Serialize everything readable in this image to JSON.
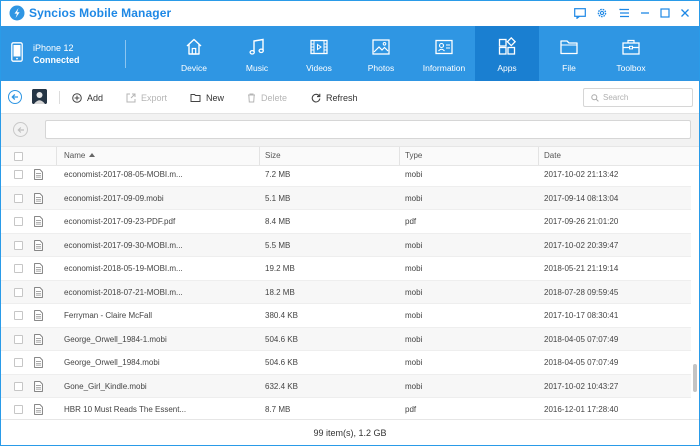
{
  "app": {
    "title": "Syncios Mobile Manager",
    "accent_color": "#2f96e3",
    "window_controls": [
      "message-icon",
      "gear-icon",
      "menu-icon",
      "minimize-icon",
      "maximize-icon",
      "close-icon"
    ]
  },
  "device": {
    "name": "iPhone 12",
    "status": "Connected",
    "icon": "phone-icon"
  },
  "nav": {
    "items": [
      {
        "label": "Device",
        "icon": "home-icon"
      },
      {
        "label": "Music",
        "icon": "music-note-icon"
      },
      {
        "label": "Videos",
        "icon": "film-icon"
      },
      {
        "label": "Photos",
        "icon": "image-icon"
      },
      {
        "label": "Information",
        "icon": "contact-card-icon"
      },
      {
        "label": "Apps",
        "icon": "apps-grid-icon"
      },
      {
        "label": "File",
        "icon": "folder-icon"
      },
      {
        "label": "Toolbox",
        "icon": "toolbox-icon"
      }
    ],
    "active": "Apps"
  },
  "toolbar": {
    "add_label": "Add",
    "export_label": "Export",
    "new_label": "New",
    "delete_label": "Delete",
    "refresh_label": "Refresh",
    "search_placeholder": "Search"
  },
  "path": {
    "value": ""
  },
  "table": {
    "headers": {
      "name": "Name",
      "size": "Size",
      "type": "Type",
      "date": "Date"
    },
    "sort_column": "Name",
    "sort_direction": "ascending",
    "rows": [
      {
        "name": "economist-2017-08-05-MOBI.m...",
        "size": "7.2 MB",
        "type": "mobi",
        "date": "2017-10-02 21:13:42"
      },
      {
        "name": "economist-2017-09-09.mobi",
        "size": "5.1 MB",
        "type": "mobi",
        "date": "2017-09-14 08:13:04"
      },
      {
        "name": "economist-2017-09-23-PDF.pdf",
        "size": "8.4 MB",
        "type": "pdf",
        "date": "2017-09-26 21:01:20"
      },
      {
        "name": "economist-2017-09-30-MOBI.m...",
        "size": "5.5 MB",
        "type": "mobi",
        "date": "2017-10-02 20:39:47"
      },
      {
        "name": "economist-2018-05-19-MOBI.m...",
        "size": "19.2 MB",
        "type": "mobi",
        "date": "2018-05-21 21:19:14"
      },
      {
        "name": "economist-2018-07-21-MOBI.m...",
        "size": "18.2 MB",
        "type": "mobi",
        "date": "2018-07-28 09:59:45"
      },
      {
        "name": "Ferryman - Claire McFall",
        "size": "380.4 KB",
        "type": "mobi",
        "date": "2017-10-17 08:30:41"
      },
      {
        "name": "George_Orwell_1984-1.mobi",
        "size": "504.6 KB",
        "type": "mobi",
        "date": "2018-04-05 07:07:49"
      },
      {
        "name": "George_Orwell_1984.mobi",
        "size": "504.6 KB",
        "type": "mobi",
        "date": "2018-04-05 07:07:49"
      },
      {
        "name": "Gone_Girl_Kindle.mobi",
        "size": "632.4 KB",
        "type": "mobi",
        "date": "2017-10-02 10:43:27"
      },
      {
        "name": "HBR 10 Must Reads The Essent...",
        "size": "8.7 MB",
        "type": "pdf",
        "date": "2016-12-01 17:28:40"
      }
    ]
  },
  "status": {
    "summary": "99 item(s), 1.2 GB"
  }
}
